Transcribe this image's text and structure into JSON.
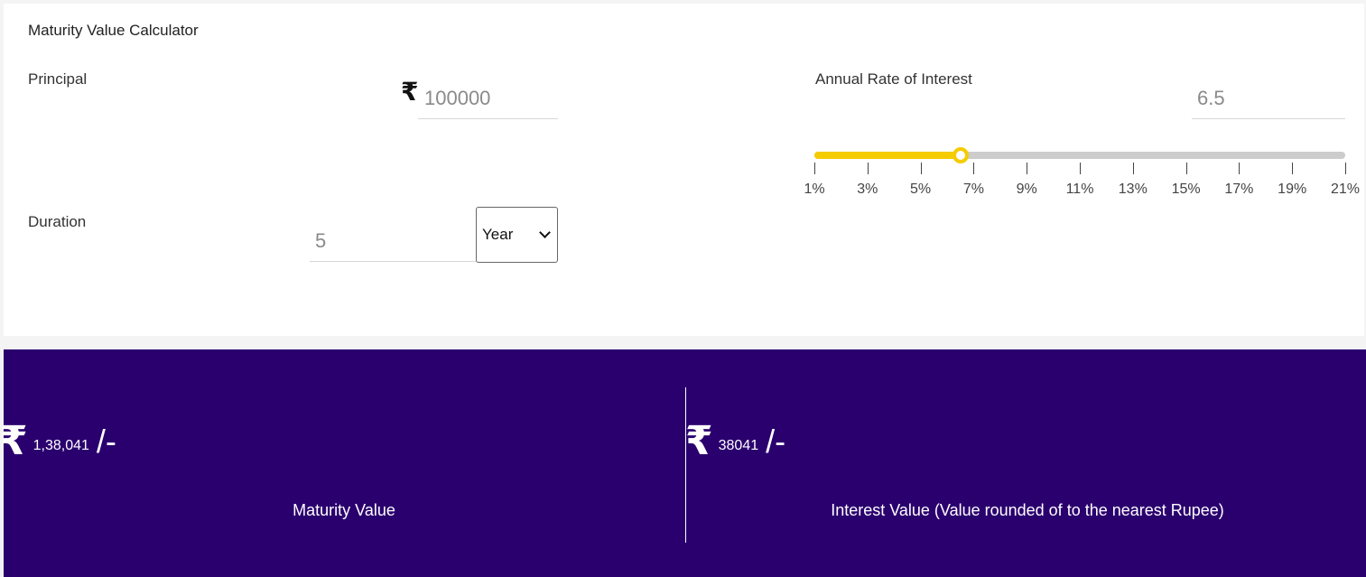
{
  "calculator": {
    "title": "Maturity Value Calculator",
    "principal": {
      "label": "Principal",
      "currency_icon": "₹",
      "value": "100000"
    },
    "duration": {
      "label": "Duration",
      "value": "5",
      "unit_selected": "Year"
    },
    "rate": {
      "label": "Annual Rate of Interest",
      "value": "6.5",
      "slider": {
        "min": 1,
        "max": 21,
        "current": 6.5,
        "ticks": [
          "1%",
          "3%",
          "5%",
          "7%",
          "9%",
          "11%",
          "13%",
          "15%",
          "17%",
          "19%",
          "21%"
        ]
      }
    }
  },
  "results": {
    "maturity": {
      "currency_icon": "₹",
      "amount": "1,38,041",
      "suffix": "/-",
      "label": "Maturity Value"
    },
    "interest": {
      "currency_icon": "₹",
      "amount": "38041",
      "suffix": "/-",
      "label": "Interest Value (Value rounded of to the nearest Rupee)"
    }
  },
  "colors": {
    "accent": "#f5cc00",
    "track": "#cccccc",
    "results_bg": "#2a006e"
  }
}
